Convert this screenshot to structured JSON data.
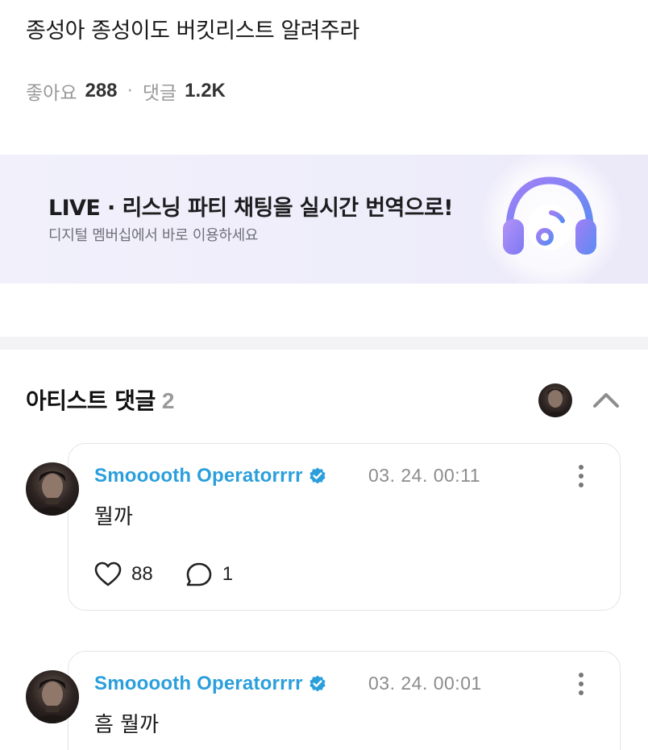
{
  "post": {
    "title": "종성아 종성이도 버킷리스트 알려주라",
    "likes_label": "좋아요",
    "likes_count": "288",
    "separator": "·",
    "comments_label": "댓글",
    "comments_count": "1.2K"
  },
  "banner": {
    "title": "LIVE · 리스닝 파티 채팅을 실시간 번역으로!",
    "subtitle": "디지털 멤버십에서 바로 이용하세요",
    "icon": "headphones-music-icon"
  },
  "artist_comments": {
    "title": "아티스트 댓글",
    "count": "2",
    "comments": [
      {
        "author": "Smooooth Operatorrrr",
        "timestamp": "03. 24. 00:11",
        "text": "뭘까",
        "likes": "88",
        "replies": "1"
      },
      {
        "author": "Smooooth Operatorrrr",
        "timestamp": "03. 24. 00:01",
        "text": "흠 뭘까"
      }
    ]
  },
  "colors": {
    "author": "#2a9fdc",
    "verified": "#2a9fdc",
    "banner_bg": "#efeefb",
    "icon_gradient_start": "#9b7bf5",
    "icon_gradient_end": "#5a8cf2"
  }
}
